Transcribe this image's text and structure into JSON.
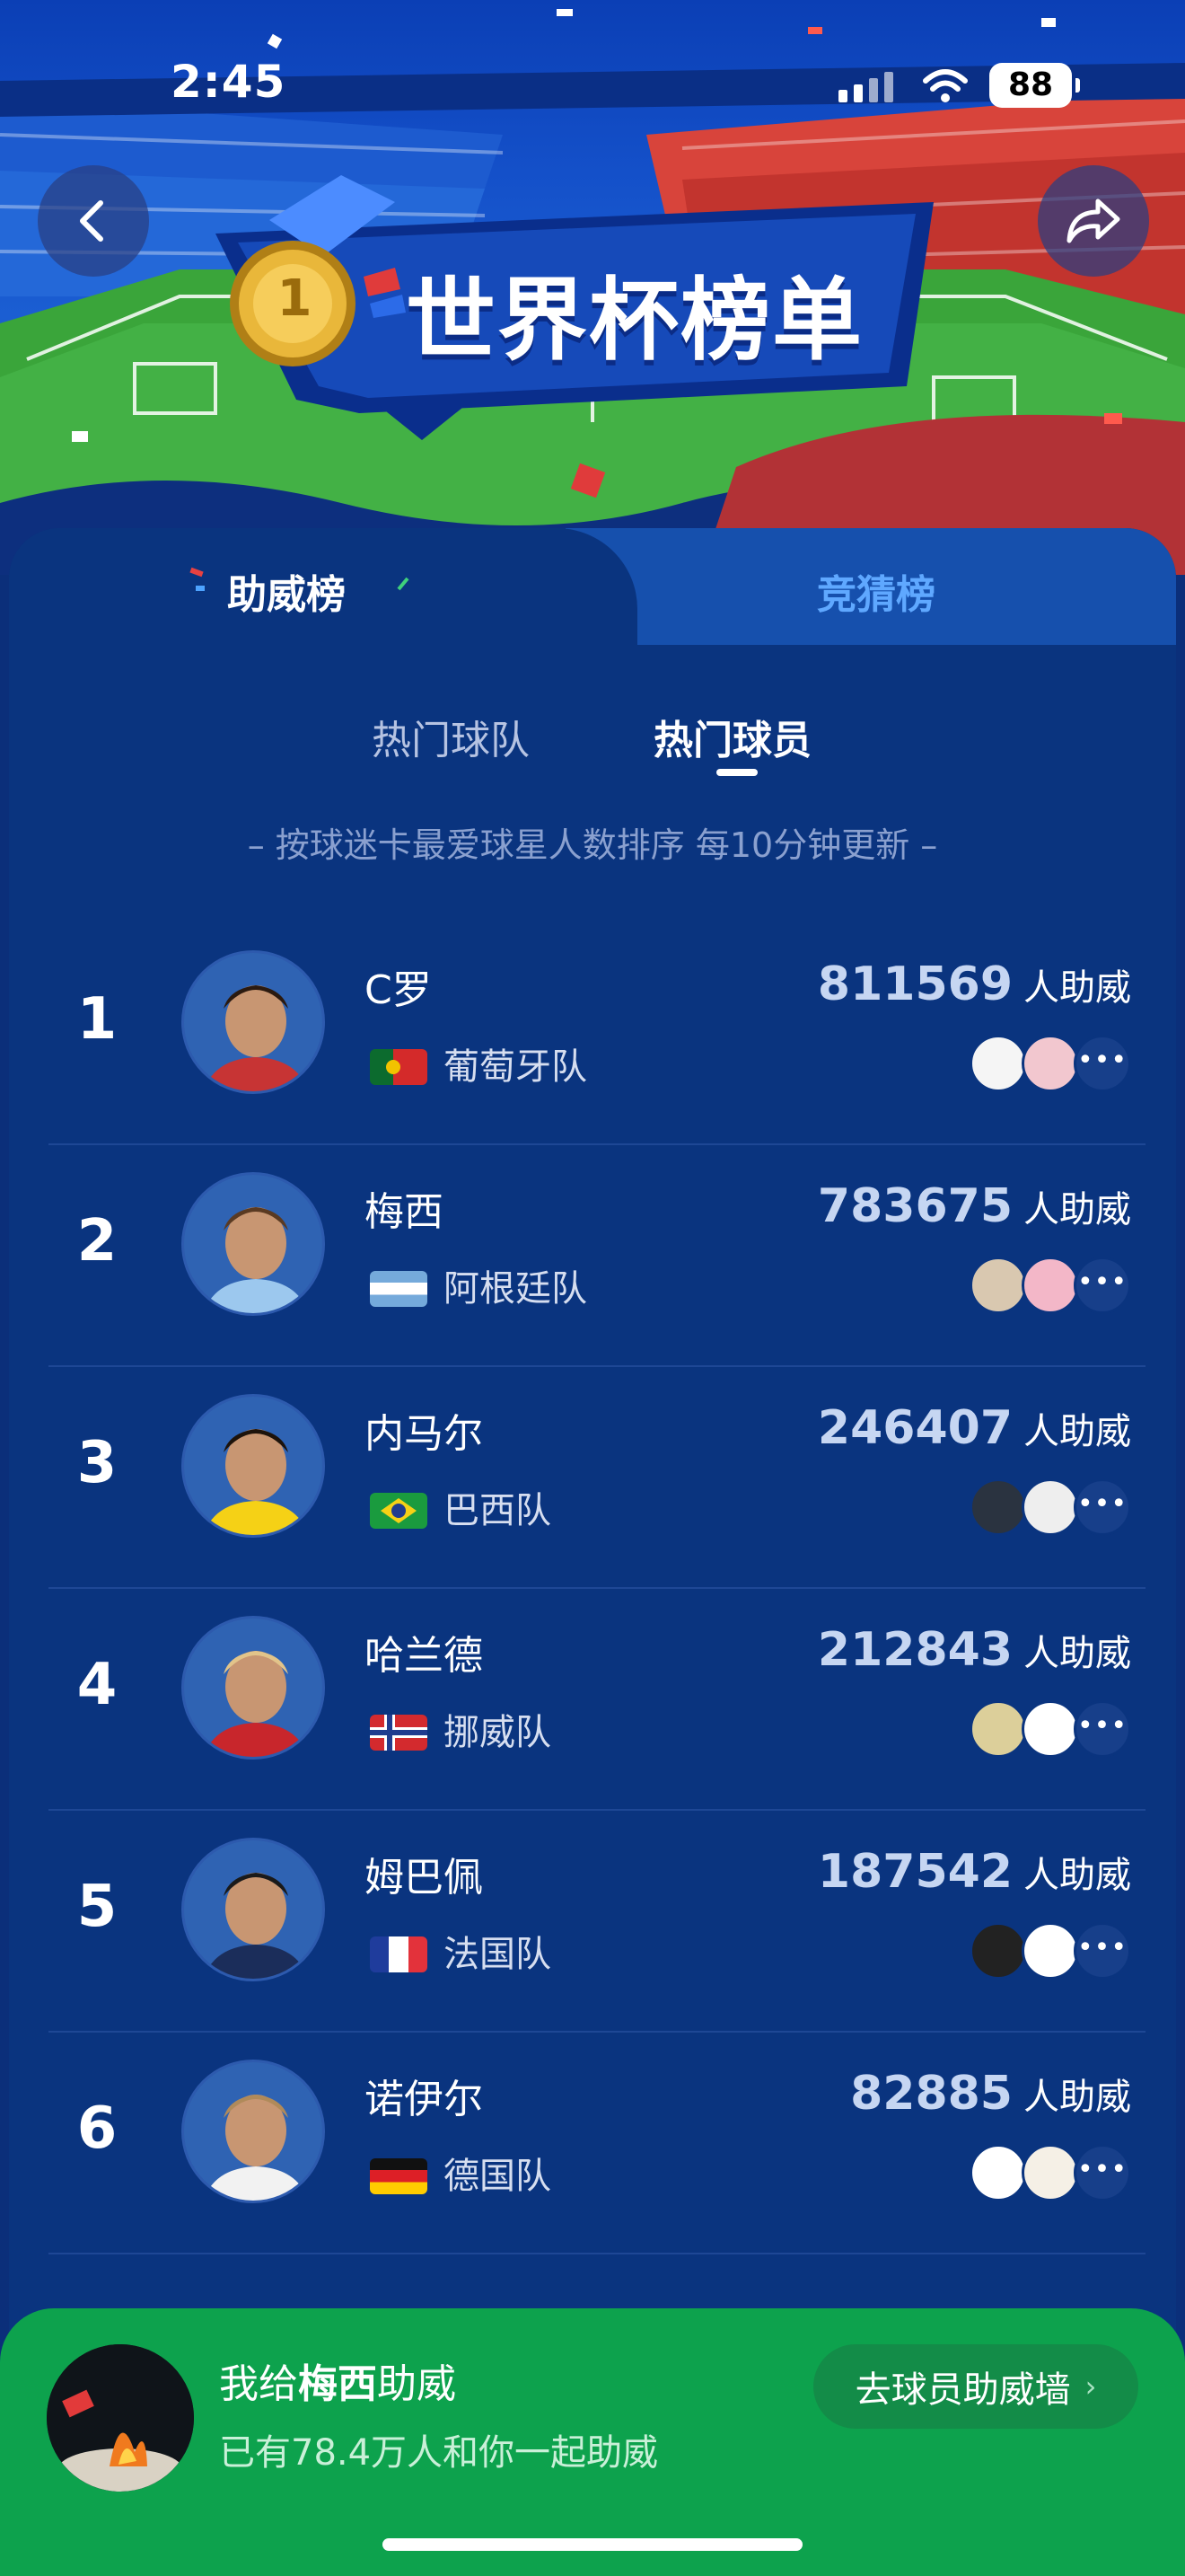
{
  "status": {
    "time": "2:45",
    "battery": "88"
  },
  "header": {
    "title": "世界杯榜单",
    "medal": "1"
  },
  "tabs": [
    {
      "label": "助威榜",
      "active": true
    },
    {
      "label": "竞猜榜",
      "active": false
    }
  ],
  "subtabs": [
    {
      "label": "热门球队",
      "active": false
    },
    {
      "label": "热门球员",
      "active": true
    }
  ],
  "note": "– 按球迷卡最爱球星人数排序   每10分钟更新 –",
  "players": [
    {
      "rank": "1",
      "name": "C罗",
      "team": "葡萄牙队",
      "flag": "portugal",
      "votes": "811569",
      "suffix": "人助威"
    },
    {
      "rank": "2",
      "name": "梅西",
      "team": "阿根廷队",
      "flag": "argentina",
      "votes": "783675",
      "suffix": "人助威"
    },
    {
      "rank": "3",
      "name": "内马尔",
      "team": "巴西队",
      "flag": "brazil",
      "votes": "246407",
      "suffix": "人助威"
    },
    {
      "rank": "4",
      "name": "哈兰德",
      "team": "挪威队",
      "flag": "norway",
      "votes": "212843",
      "suffix": "人助威"
    },
    {
      "rank": "5",
      "name": "姆巴佩",
      "team": "法国队",
      "flag": "france",
      "votes": "187542",
      "suffix": "人助威"
    },
    {
      "rank": "6",
      "name": "诺伊尔",
      "team": "德国队",
      "flag": "germany",
      "votes": "82885",
      "suffix": "人助威"
    }
  ],
  "more_icon": "•••",
  "bottom": {
    "cheer_prefix": "我给",
    "cheer_player": "梅西",
    "cheer_suffix": "助威",
    "count_text": "已有78.4万人和你一起助威",
    "wall_button": "去球员助威墙",
    "wall_chevron": "›"
  },
  "colors": {
    "background": "#0a347f",
    "active_tab_text": "#ffffff",
    "inactive_tab_text": "#5fa8ff",
    "bottom_bar": "#0da24d"
  },
  "icons": [
    "back-icon",
    "share-icon",
    "medal-icon",
    "wifi-icon",
    "signal-icon"
  ]
}
